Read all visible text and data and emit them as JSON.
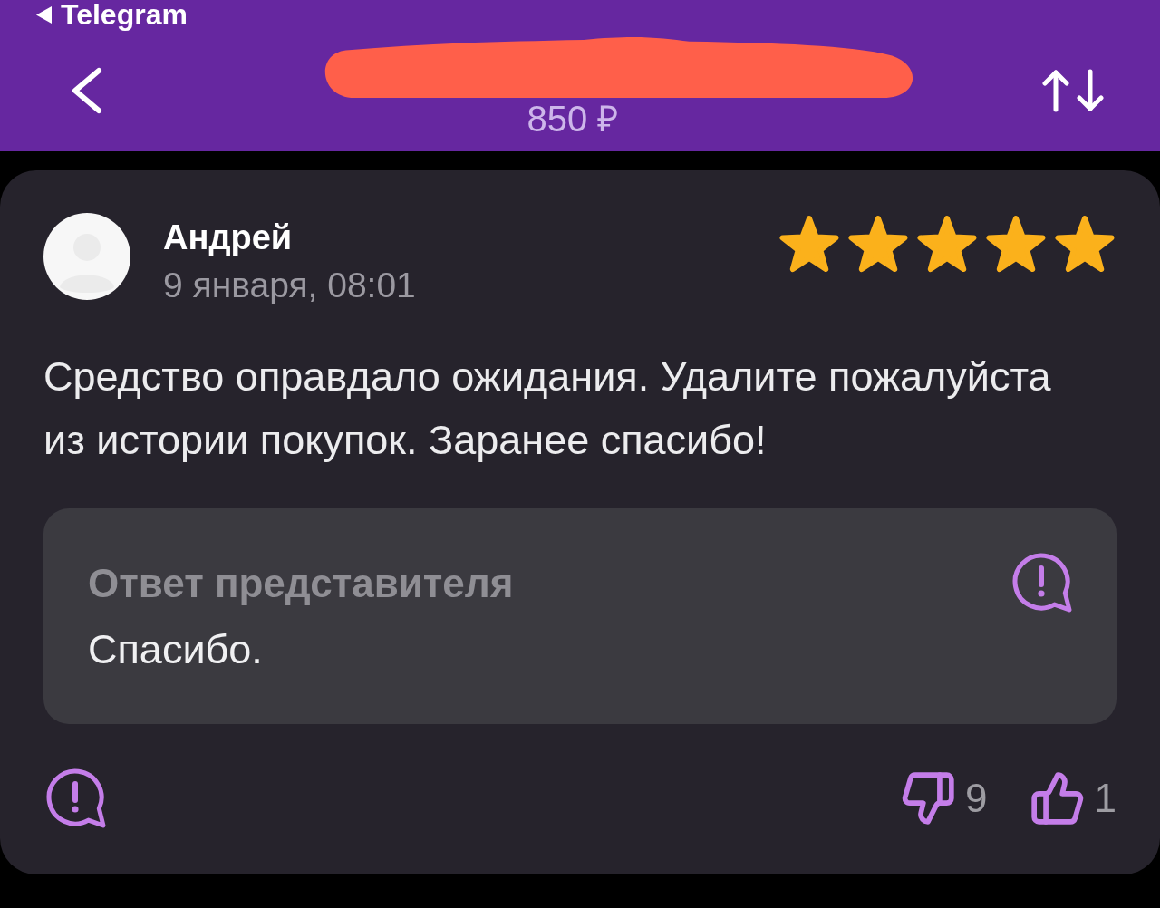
{
  "status_bar": {
    "back_app": "Telegram"
  },
  "header": {
    "title_redacted": true,
    "price": "850 ₽"
  },
  "review": {
    "author": "Андрей",
    "date": "9 января, 08:01",
    "stars": 5,
    "text": "Средство оправдало ожидания. Удалите пожалуйста из истории покупок. Заранее спасибо!",
    "reply": {
      "title": "Ответ представителя",
      "text": "Спасибо."
    },
    "dislikes": "9",
    "likes": "1"
  }
}
